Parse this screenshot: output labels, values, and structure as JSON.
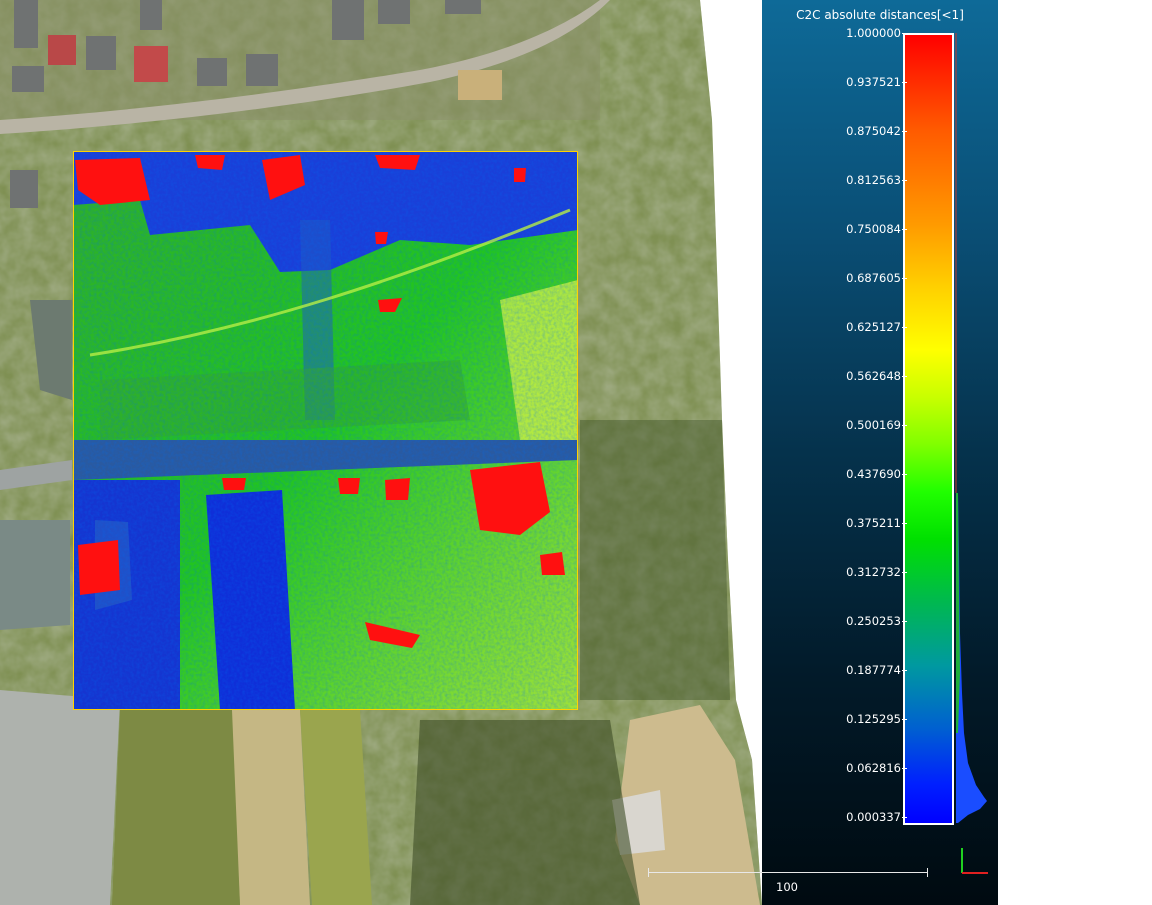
{
  "scalar_field": {
    "title": "C2C absolute distances[<1]",
    "ticks": [
      "1.000000",
      "0.937521",
      "0.875042",
      "0.812563",
      "0.750084",
      "0.687605",
      "0.625127",
      "0.562648",
      "0.500169",
      "0.437690",
      "0.375211",
      "0.312732",
      "0.250253",
      "0.187774",
      "0.125295",
      "0.062816",
      "0.000337"
    ],
    "colors": {
      "max": "#ff0000",
      "mid": "#ffff00",
      "low_mid": "#00ff00",
      "min": "#0000ff"
    }
  },
  "scale": {
    "label": "100"
  },
  "icons": {
    "trihedron": "axis-trihedron-icon"
  }
}
